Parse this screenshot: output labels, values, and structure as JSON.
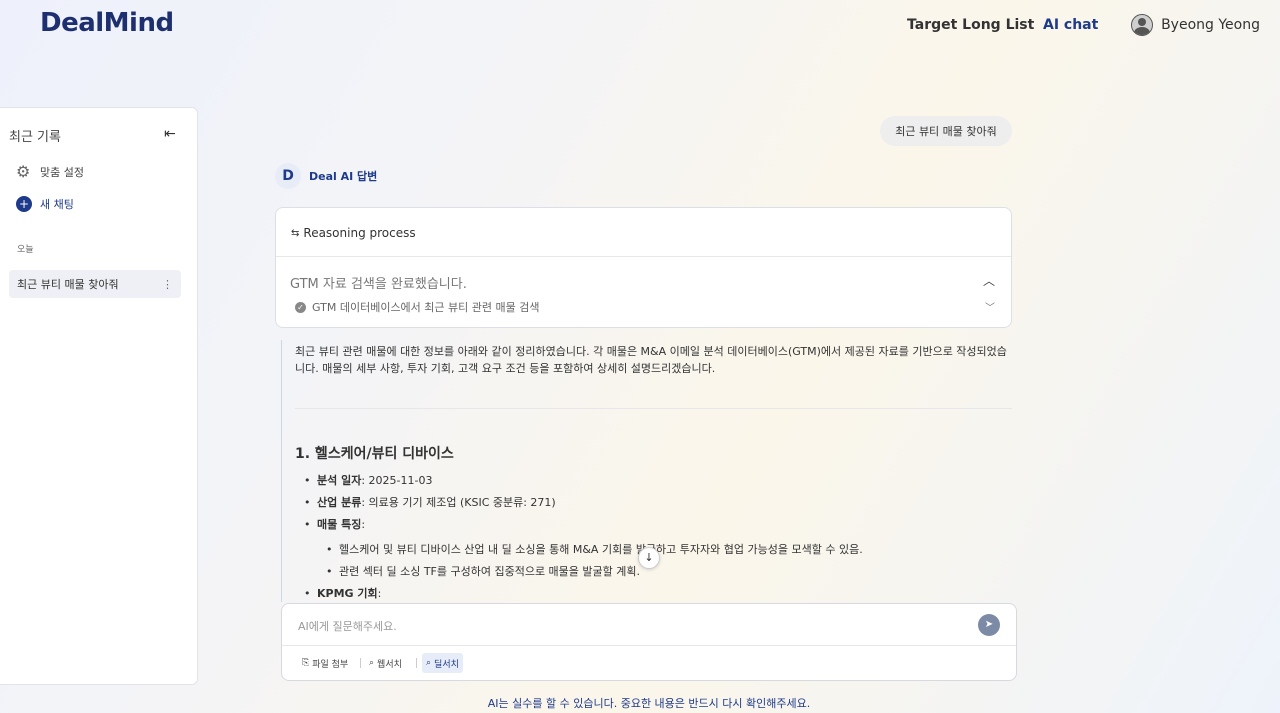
{
  "header": {
    "logo": "DealMind",
    "nav": [
      "Target Long List",
      "AI chat"
    ],
    "user_name": "Byeong Yeong"
  },
  "sidebar": {
    "title": "최근 기록",
    "settings_label": "맞춤 설정",
    "new_chat_label": "새 채팅",
    "group_today": "오늘",
    "items": [
      {
        "label": "최근 뷰티 매물 찾아줘"
      }
    ]
  },
  "chat": {
    "user_message": "최근 뷰티 매물 찾아줘",
    "ai_badge": "D",
    "ai_name": "Deal AI 답변",
    "reasoning": {
      "title": "Reasoning process",
      "status": "GTM 자료 검색을 완료했습니다.",
      "step": "GTM 데이터베이스에서 최근 뷰티 관련 매물 검색"
    },
    "intro": "최근 뷰티 관련 매물에 대한 정보를 아래와 같이 정리하였습니다. 각 매물은 M&A 이메일 분석 데이터베이스(GTM)에서 제공된 자료를 기반으로 작성되었습니다. 매물의 세부 사항, 투자 기회, 고객 요구 조건 등을 포함하여 상세히 설명드리겠습니다.",
    "section_title": "1. 헬스케어/뷰티 디바이스",
    "fields": {
      "date_key": "분석 일자",
      "date_val": ": 2025-11-03",
      "industry_key": "산업 분류",
      "industry_val": ": 의료용 기기 제조업 (KSIC 중분류: 271)",
      "features_key": "매물 특징",
      "features_val": ":",
      "feature_items": [
        "헬스케어 및 뷰티 디바이스 산업 내 딜 소싱을 통해 M&A 기회를 발굴하고 투자자와 협업 가능성을 모색할 수 있음.",
        "관련 섹터 딜 소싱 TF를 구성하여 집중적으로 매물을 발굴할 계획."
      ],
      "kpmg_key": "KPMG 기회",
      "kpmg_val": ":"
    }
  },
  "composer": {
    "placeholder": "AI에게 질문해주세요.",
    "tools": [
      "파일 첨부",
      "웹서치",
      "딜서치"
    ]
  },
  "disclaimer": "AI는 실수를 할 수 있습니다. 중요한 내용은 반드시 다시 확인해주세요.",
  "colors": {
    "accent": "#1e3a8a",
    "send_button": "#7d8aa5"
  }
}
